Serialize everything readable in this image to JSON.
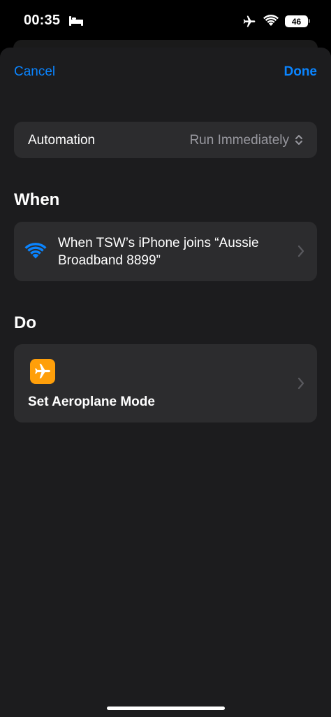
{
  "status_bar": {
    "time": "00:35",
    "battery": "46",
    "icons": [
      "bed-icon",
      "airplane-icon",
      "wifi-icon",
      "battery-icon"
    ]
  },
  "nav": {
    "cancel_label": "Cancel",
    "done_label": "Done"
  },
  "automation": {
    "label": "Automation",
    "value": "Run Immediately"
  },
  "when": {
    "heading": "When",
    "trigger_line1": "When TSW’s iPhone joins “Aussie",
    "trigger_line2": "Broadband 8899”",
    "icon": "wifi-icon"
  },
  "do": {
    "heading": "Do",
    "action_label": "Set Aeroplane Mode",
    "icon": "airplane-icon"
  },
  "colors": {
    "accent": "#0a84ff",
    "action_icon_bg": "#ff9f0a",
    "card_bg": "#2c2c2e",
    "sheet_bg": "#1c1c1e",
    "secondary_text": "#98989f"
  }
}
